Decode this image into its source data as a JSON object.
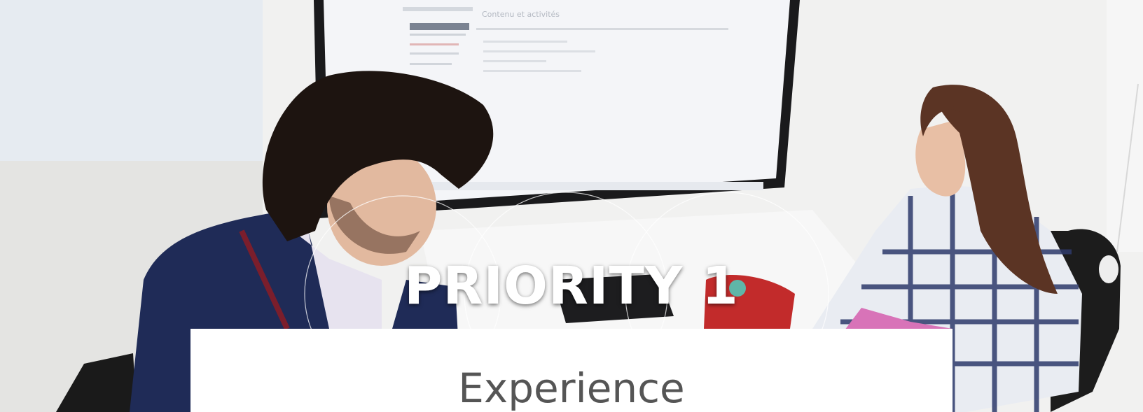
{
  "hero": {
    "title": "PRIORITY 1",
    "screen": {
      "heading": "Contenu et activités"
    }
  },
  "card": {
    "title": "Experience"
  },
  "colors": {
    "title_text": "#ffffff",
    "card_bg": "#ffffff",
    "card_text": "#555555",
    "wall": "#e9eaec",
    "sweater": "#1e2a55",
    "plaid": "#2e3a6b"
  }
}
